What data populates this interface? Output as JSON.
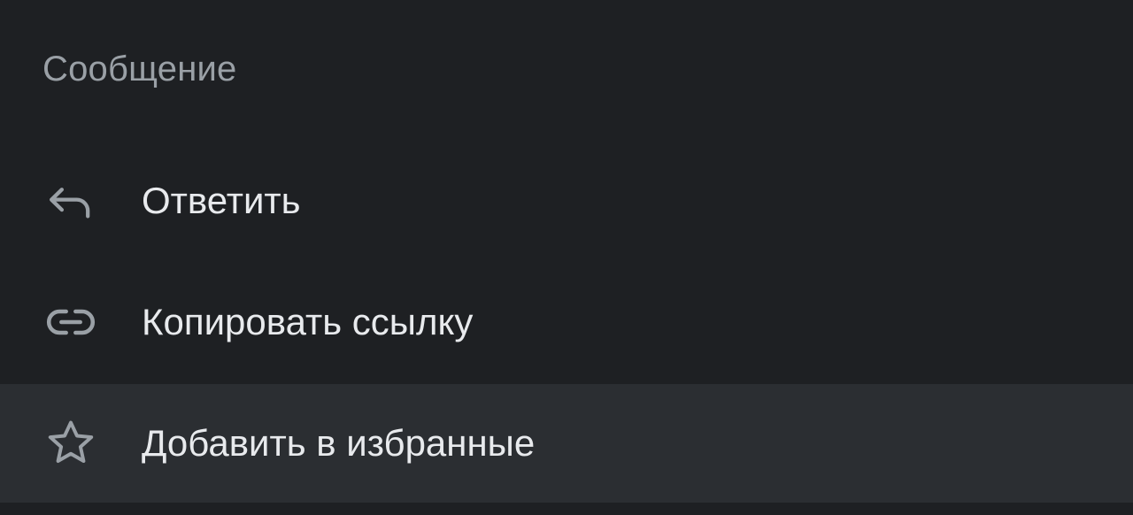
{
  "sheet": {
    "title": "Сообщение",
    "items": [
      {
        "label": "Ответить",
        "icon": "reply-icon"
      },
      {
        "label": "Копировать ссылку",
        "icon": "link-icon"
      },
      {
        "label": "Добавить в избранные",
        "icon": "star-icon",
        "highlighted": true
      }
    ]
  },
  "colors": {
    "background": "#1e2023",
    "highlight": "#2b2e32",
    "title_text": "#9aa0a6",
    "item_text": "#e8eaed",
    "icon": "#9aa0a6"
  }
}
